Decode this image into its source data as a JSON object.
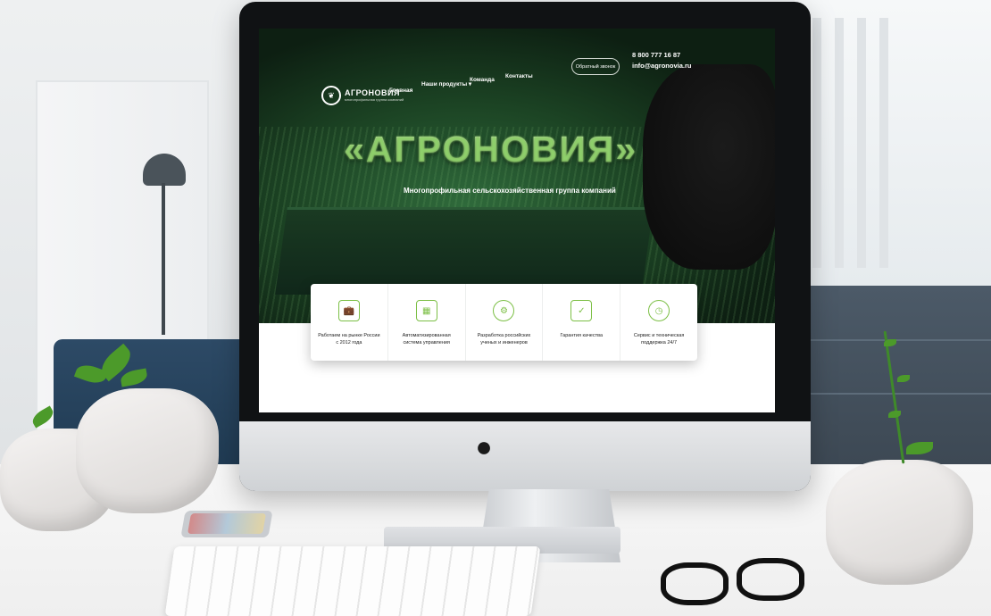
{
  "site": {
    "logo": {
      "name": "АГРОНОВИЯ",
      "tagline": "многопрофильная группа компаний"
    },
    "nav": [
      {
        "label": "Главная"
      },
      {
        "label": "Наши продукты ▾"
      },
      {
        "label": "Команда"
      },
      {
        "label": "Контакты"
      }
    ],
    "callback_button": "Обратный звонок",
    "phone": "8 800 777 16 87",
    "email": "info@agronovia.ru",
    "hero": {
      "title": "«АГРОНОВИЯ»",
      "subtitle": "Многопрофильная сельскохозяйственная группа компаний"
    },
    "features": [
      {
        "icon": "briefcase-icon",
        "glyph": "💼",
        "text": "Работаем на рынке России с 2012 года"
      },
      {
        "icon": "chip-icon",
        "glyph": "▦",
        "text": "Автоматизированная система управления"
      },
      {
        "icon": "gear-icon",
        "glyph": "⚙",
        "text": "Разработка российских ученых и инженеров"
      },
      {
        "icon": "shield-icon",
        "glyph": "✓",
        "text": "Гарантия качества"
      },
      {
        "icon": "clock-icon",
        "glyph": "◷",
        "text": "Сервис и техническая поддержка 24/7"
      }
    ]
  },
  "colors": {
    "accent": "#7cbf45",
    "hero_dark": "#0d1f12",
    "card_bg": "#ffffff"
  }
}
